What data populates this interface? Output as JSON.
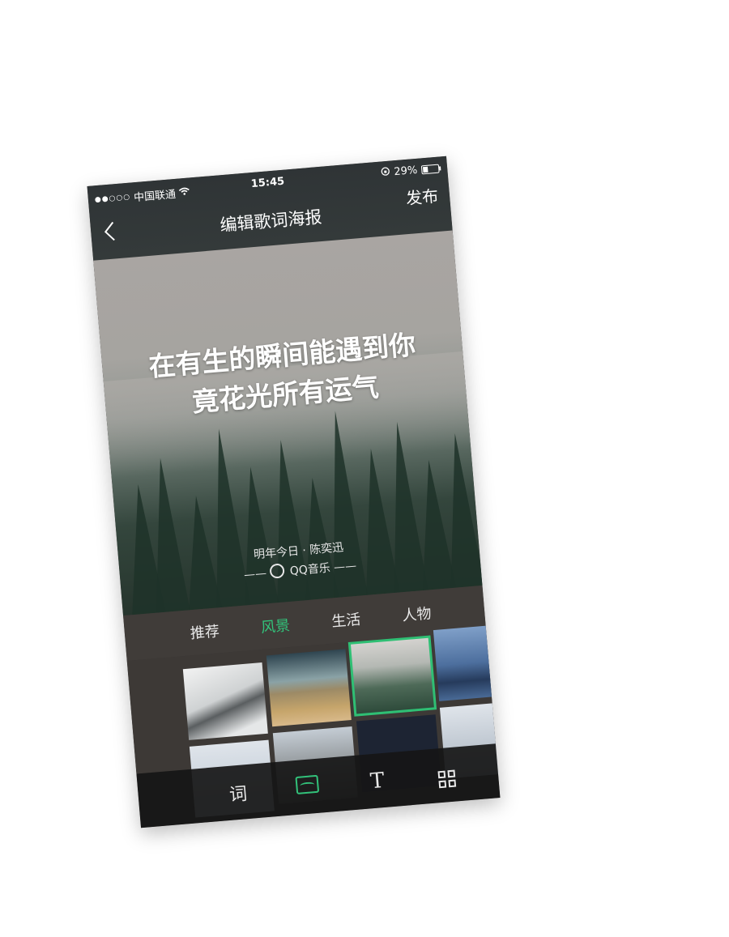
{
  "status_bar": {
    "carrier": "中国联通",
    "signal": "●●○○○",
    "time": "15:45",
    "battery": "29%"
  },
  "nav": {
    "back_icon": "chevron-left-icon",
    "title": "编辑歌词海报",
    "publish_label": "发布"
  },
  "poster": {
    "lyric_line_1": "在有生的瞬间能遇到你",
    "lyric_line_2": "竟花光所有运气",
    "song_credit": "明年今日 · 陈奕迅",
    "brand": "QQ音乐"
  },
  "tabs": [
    {
      "label": "推荐",
      "active": false
    },
    {
      "label": "风景",
      "active": true
    },
    {
      "label": "生活",
      "active": false
    },
    {
      "label": "人物",
      "active": false
    }
  ],
  "thumbnails": [
    {
      "name": "snowy-mountain",
      "selected": false
    },
    {
      "name": "beach",
      "selected": false
    },
    {
      "name": "foggy-forest",
      "selected": true
    },
    {
      "name": "lake-trees",
      "selected": false
    },
    {
      "name": "sky",
      "selected": false
    },
    {
      "name": "bare-trees",
      "selected": false
    },
    {
      "name": "night",
      "selected": false
    },
    {
      "name": "horizon",
      "selected": false
    }
  ],
  "toolbar": {
    "lyrics_label": "词",
    "image_icon": "image-icon",
    "text_icon": "text-icon",
    "text_glyph": "T",
    "qr_icon": "qr-code-icon"
  },
  "colors": {
    "accent_green": "#32c27a",
    "header_bg": "#343a3a",
    "panel_bg": "#3d3936"
  }
}
